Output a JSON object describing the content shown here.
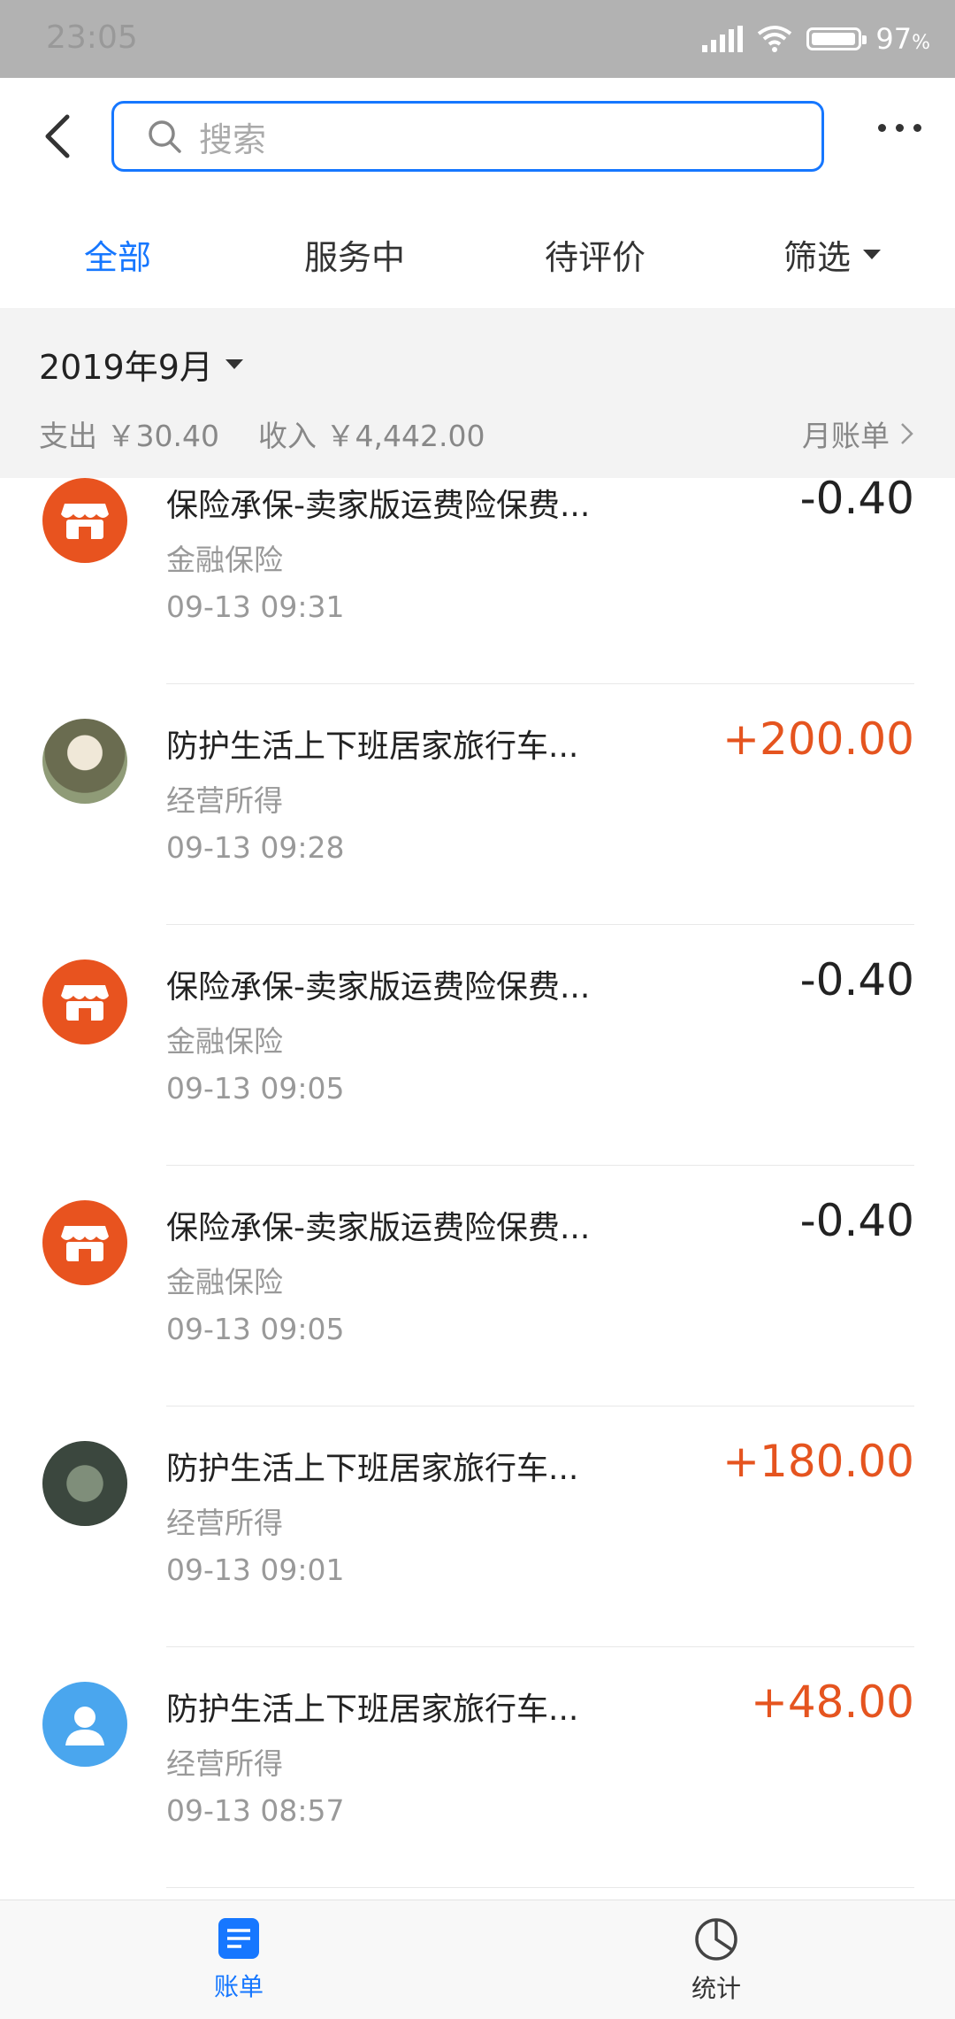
{
  "status_bar": {
    "time": "23:05",
    "battery": "97",
    "battery_unit": "%",
    "battery_level": 0.97
  },
  "search": {
    "placeholder": "搜索"
  },
  "tabs": [
    {
      "label": "全部",
      "active": true
    },
    {
      "label": "服务中",
      "active": false
    },
    {
      "label": "待评价",
      "active": false
    },
    {
      "label": "筛选",
      "active": false
    }
  ],
  "month": {
    "selected": "2019年9月",
    "expense_label": "支出",
    "expense_value": "￥30.40",
    "income_label": "收入",
    "income_value": "￥4,442.00",
    "bill_link": "月账单"
  },
  "transactions": [
    {
      "title": "保险承保-卖家版运费险保费...",
      "category": "金融保险",
      "time": "09-13  09:31",
      "amount": "-0.40",
      "type": "expense",
      "icon": "shop-icon"
    },
    {
      "title": "防护生活上下班居家旅行车...",
      "category": "经营所得",
      "time": "09-13  09:28",
      "amount": "+200.00",
      "type": "income",
      "icon": "user-photo"
    },
    {
      "title": "保险承保-卖家版运费险保费...",
      "category": "金融保险",
      "time": "09-13  09:05",
      "amount": "-0.40",
      "type": "expense",
      "icon": "shop-icon"
    },
    {
      "title": "保险承保-卖家版运费险保费...",
      "category": "金融保险",
      "time": "09-13  09:05",
      "amount": "-0.40",
      "type": "expense",
      "icon": "shop-icon"
    },
    {
      "title": "防护生活上下班居家旅行车...",
      "category": "经营所得",
      "time": "09-13  09:01",
      "amount": "+180.00",
      "type": "income",
      "icon": "user-photo"
    },
    {
      "title": "防护生活上下班居家旅行车...",
      "category": "经营所得",
      "time": "09-13  08:57",
      "amount": "+48.00",
      "type": "income",
      "icon": "default-user-icon"
    }
  ],
  "bottom_nav": [
    {
      "label": "账单",
      "active": true,
      "icon": "bill-icon"
    },
    {
      "label": "统计",
      "active": false,
      "icon": "pie-chart-icon"
    }
  ],
  "colors": {
    "accent": "#1677ff",
    "income": "#e5541f",
    "shop": "#e8531f"
  }
}
